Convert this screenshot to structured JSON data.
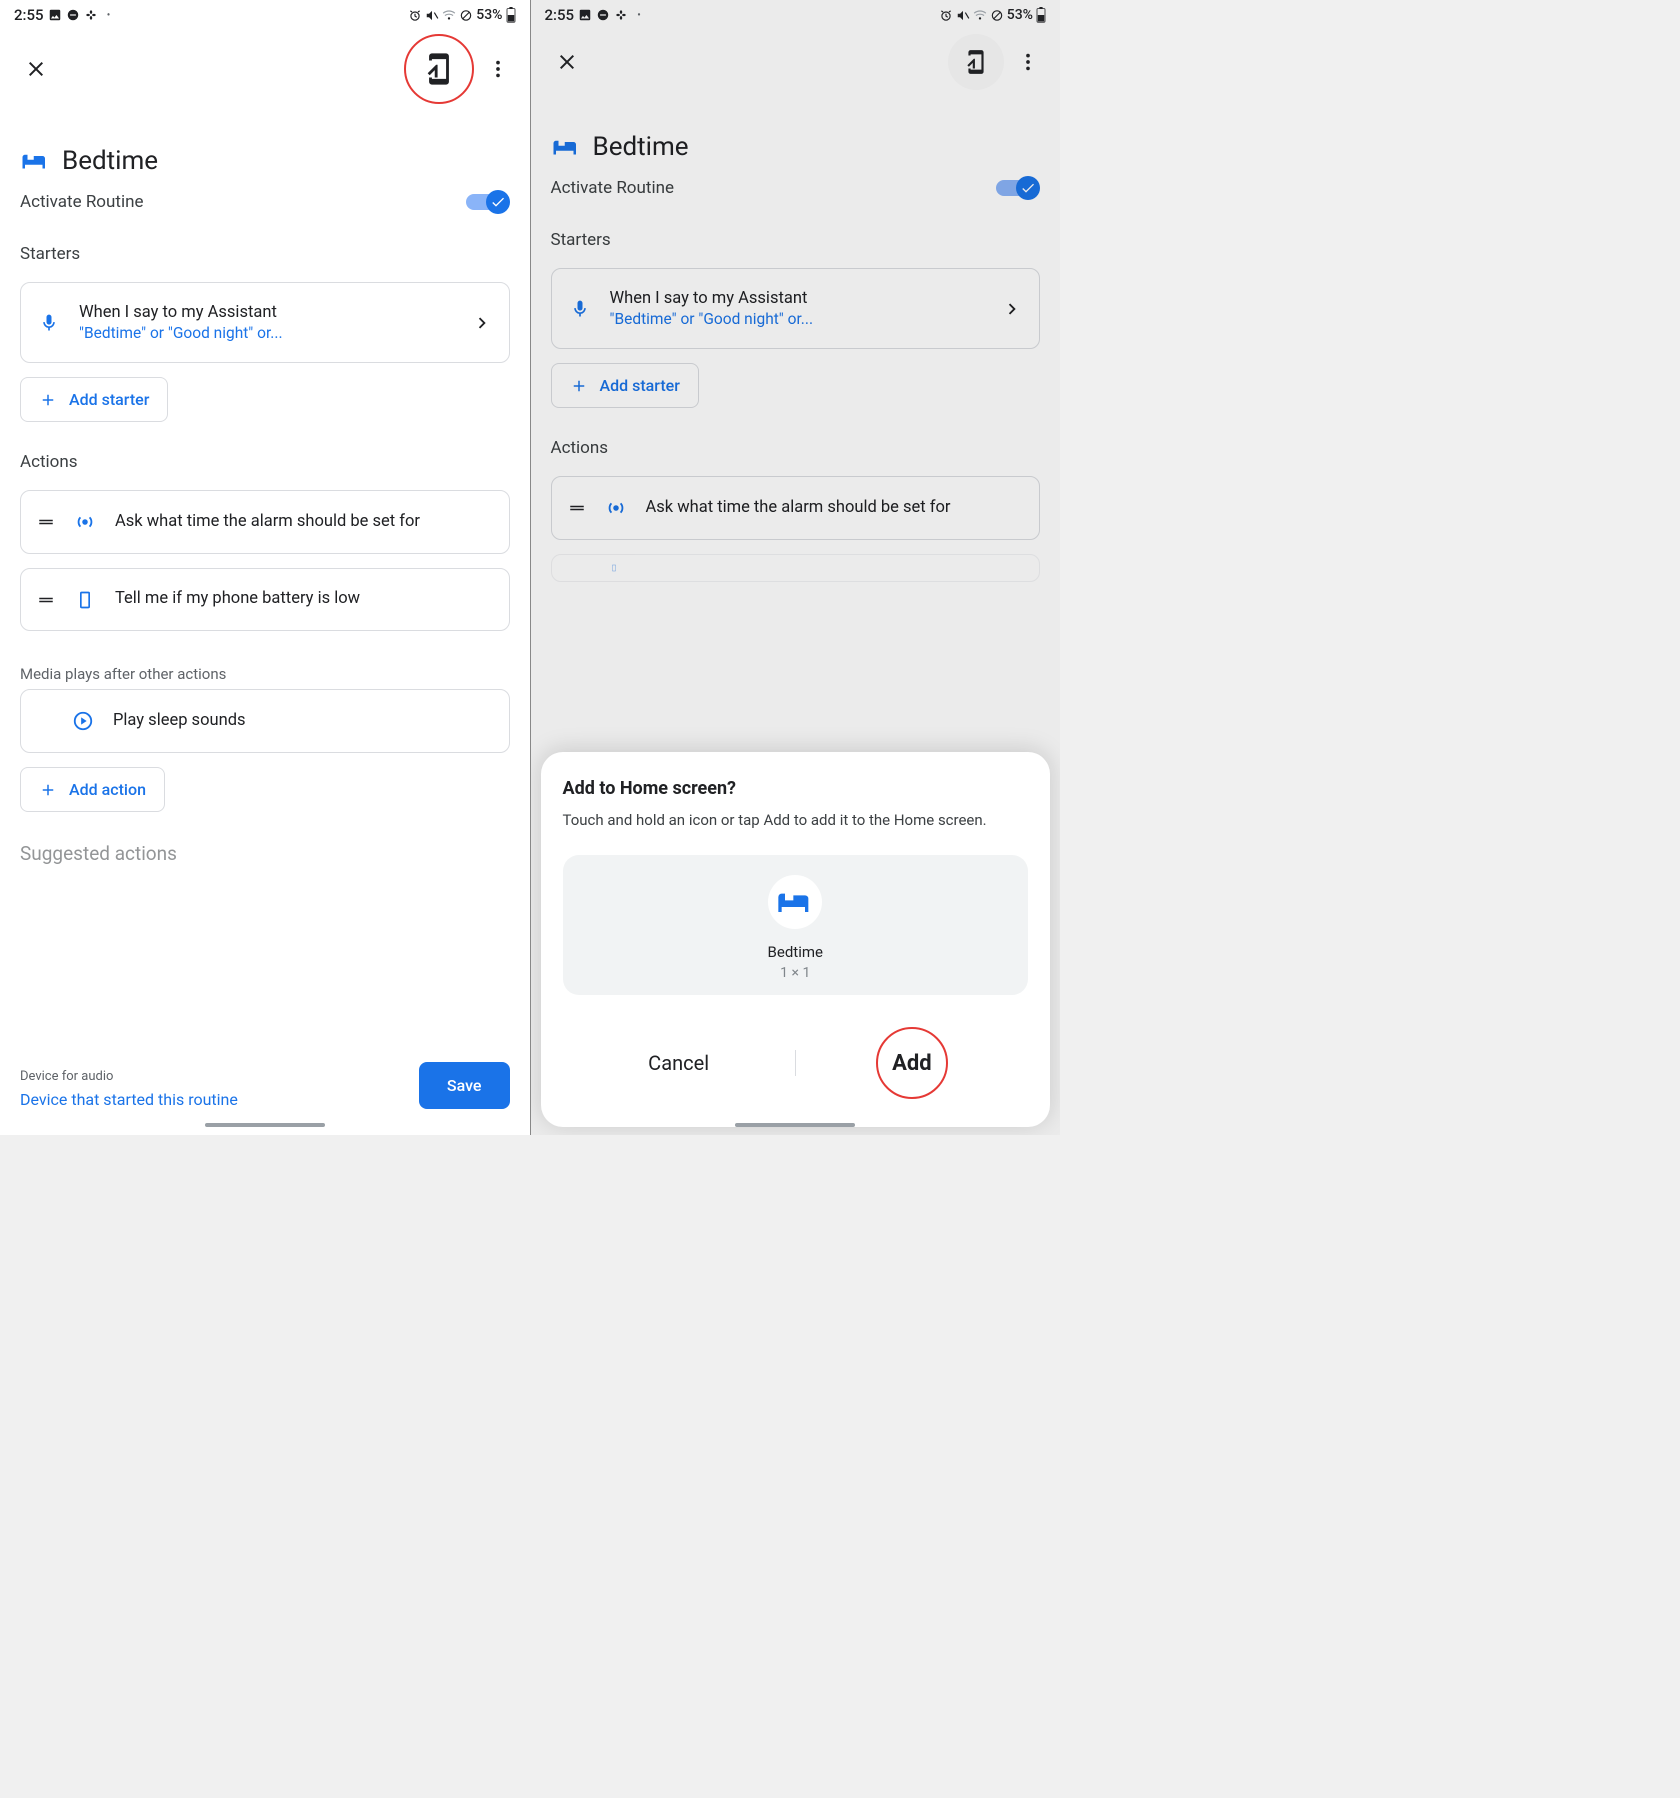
{
  "status": {
    "time": "2:55",
    "battery_text": "53%"
  },
  "routine": {
    "name": "Bedtime",
    "activate_label": "Activate Routine",
    "activated": true
  },
  "starters": {
    "heading": "Starters",
    "item": {
      "title": "When I say to my Assistant",
      "subtitle": "\"Bedtime\" or \"Good night\" or..."
    },
    "add_label": "Add starter"
  },
  "actions": {
    "heading": "Actions",
    "items": [
      {
        "text": "Ask what time the alarm should be set for"
      },
      {
        "text": "Tell me if my phone battery is low"
      }
    ],
    "media_note": "Media plays after other actions",
    "media_item": "Play sleep sounds",
    "add_label": "Add action",
    "suggested_heading": "Suggested actions"
  },
  "footer": {
    "device_label": "Device for audio",
    "device_value": "Device that started this routine",
    "save_label": "Save"
  },
  "dialog": {
    "title": "Add to Home screen?",
    "message": "Touch and hold an icon or tap Add to add it to the Home screen.",
    "shortcut_name": "Bedtime",
    "shortcut_size": "1 × 1",
    "cancel": "Cancel",
    "add": "Add"
  }
}
